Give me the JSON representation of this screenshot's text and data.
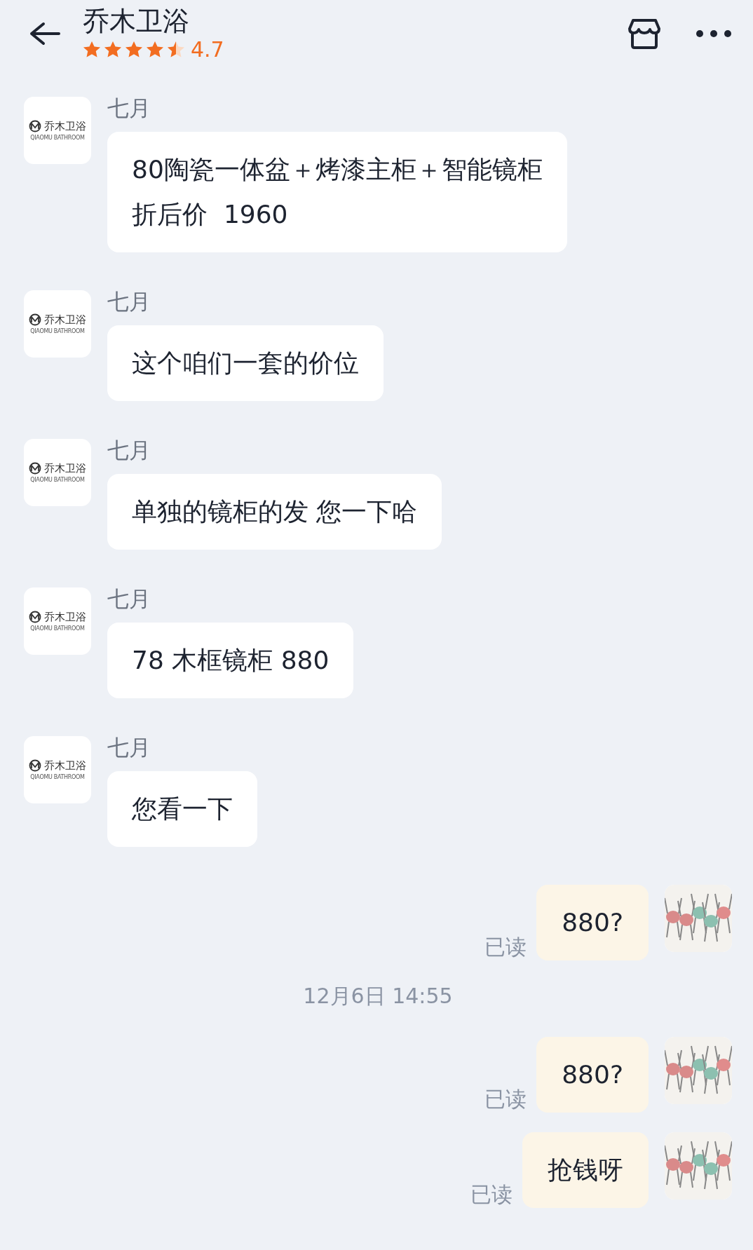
{
  "header": {
    "title": "乔木卫浴",
    "stars": 4.5,
    "rating": "4.7"
  },
  "messages": [
    {
      "kind": "received",
      "sender": "七月",
      "logo_text": "乔木卫浴",
      "logo_sub": "QIAOMU BATHROOM",
      "lines": [
        "80陶瓷一体盆＋烤漆主柜＋智能镜柜",
        "折后价  1960"
      ]
    },
    {
      "kind": "received",
      "sender": "七月",
      "logo_text": "乔木卫浴",
      "logo_sub": "QIAOMU BATHROOM",
      "lines": [
        "这个咱们一套的价位"
      ]
    },
    {
      "kind": "received",
      "sender": "七月",
      "logo_text": "乔木卫浴",
      "logo_sub": "QIAOMU BATHROOM",
      "lines": [
        "单独的镜柜的发 您一下哈"
      ]
    },
    {
      "kind": "received",
      "sender": "七月",
      "logo_text": "乔木卫浴",
      "logo_sub": "QIAOMU BATHROOM",
      "lines": [
        "78 木框镜柜 880"
      ]
    },
    {
      "kind": "received",
      "sender": "七月",
      "logo_text": "乔木卫浴",
      "logo_sub": "QIAOMU BATHROOM",
      "lines": [
        "您看一下"
      ]
    },
    {
      "kind": "sent",
      "status": "已读",
      "lines": [
        "880?"
      ]
    },
    {
      "kind": "time",
      "text": "12月6日 14:55"
    },
    {
      "kind": "sent",
      "status": "已读",
      "lines": [
        "880?"
      ]
    },
    {
      "kind": "sent",
      "status": "已读",
      "lines": [
        "抢钱呀"
      ]
    }
  ]
}
